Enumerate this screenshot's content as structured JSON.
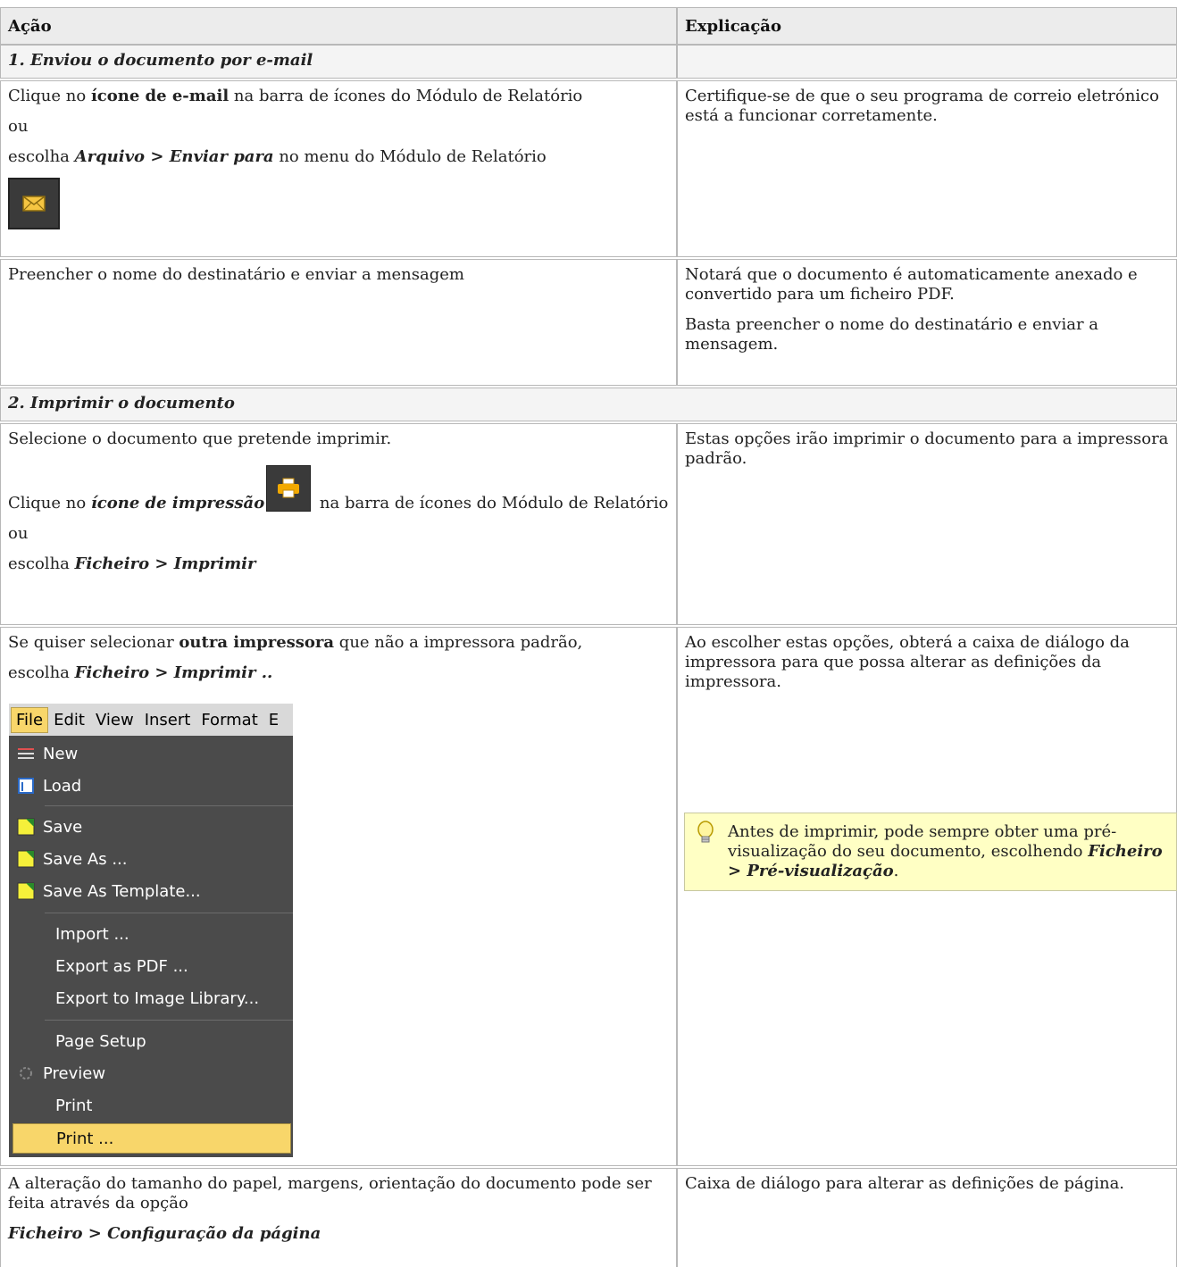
{
  "header": {
    "col1": "Ação",
    "col2": "Explicação"
  },
  "section1": {
    "title": "1. Enviou o documento por e-mail"
  },
  "row1": {
    "a_pre": "Clique no ",
    "a_bold": "ícone de e-mail",
    "a_post": " na barra de ícones do Módulo de Relatório",
    "or": "ou",
    "b_pre": "escolha ",
    "b_bi1": "Arquivo",
    "b_mid": " > ",
    "b_bi2": "Enviar para",
    "b_post": " no menu do Módulo de Relatório",
    "explain": "Certifique-se de que o seu programa de correio eletrónico está a funcionar corretamente."
  },
  "row2": {
    "action": "Preencher o nome do destinatário e enviar a mensagem",
    "explain1": "Notará que o documento é automaticamente anexado e convertido para um ficheiro PDF.",
    "explain2": "Basta preencher o nome do destinatário e enviar a mensagem."
  },
  "section2": {
    "title": "2. Imprimir o documento"
  },
  "row3": {
    "line1": "Selecione o documento que pretende imprimir.",
    "a_pre": "Clique no ",
    "a_bi": "ícone de impressão",
    "a_post": " na barra de ícones do Módulo de Relatório",
    "or": "ou",
    "b_pre": "escolha ",
    "b_bi1": "Ficheiro",
    "b_mid": " > ",
    "b_bi2": "Imprimir",
    "explain": "Estas opções irão imprimir o documento para a impressora padrão."
  },
  "row4": {
    "a_pre": "Se quiser selecionar ",
    "a_bold": "outra impressora",
    "a_post": " que não a impressora padrão,",
    "b_pre": "escolha ",
    "b_bi1": "Ficheiro",
    "b_mid": " > ",
    "b_bi2": "Imprimir ..",
    "explain": "Ao escolher estas opções, obterá a caixa de diálogo da impressora para que possa alterar as definições da impressora.",
    "tip_pre": "Antes de imprimir, pode sempre obter uma pré-visualização do seu documento, escolhendo ",
    "tip_bi1": "Ficheiro",
    "tip_mid": " > ",
    "tip_bi2": "Pré-visualização",
    "tip_end": "."
  },
  "menu": {
    "bar": [
      "File",
      "Edit",
      "View",
      "Insert",
      "Format",
      "E"
    ],
    "items": [
      "New",
      "Load",
      "Save",
      "Save As ...",
      "Save As Template...",
      "Import ...",
      "Export as PDF ...",
      "Export to Image Library...",
      "Page Setup",
      "Preview",
      "Print",
      "Print ..."
    ]
  },
  "row5": {
    "action": "A alteração do tamanho do papel, margens, orientação do documento pode ser feita através da opção",
    "b_bi1": "Ficheiro",
    "b_mid": " > ",
    "b_bi2": "Configuração da página",
    "explain": "Caixa de diálogo para alterar as definições de página."
  }
}
